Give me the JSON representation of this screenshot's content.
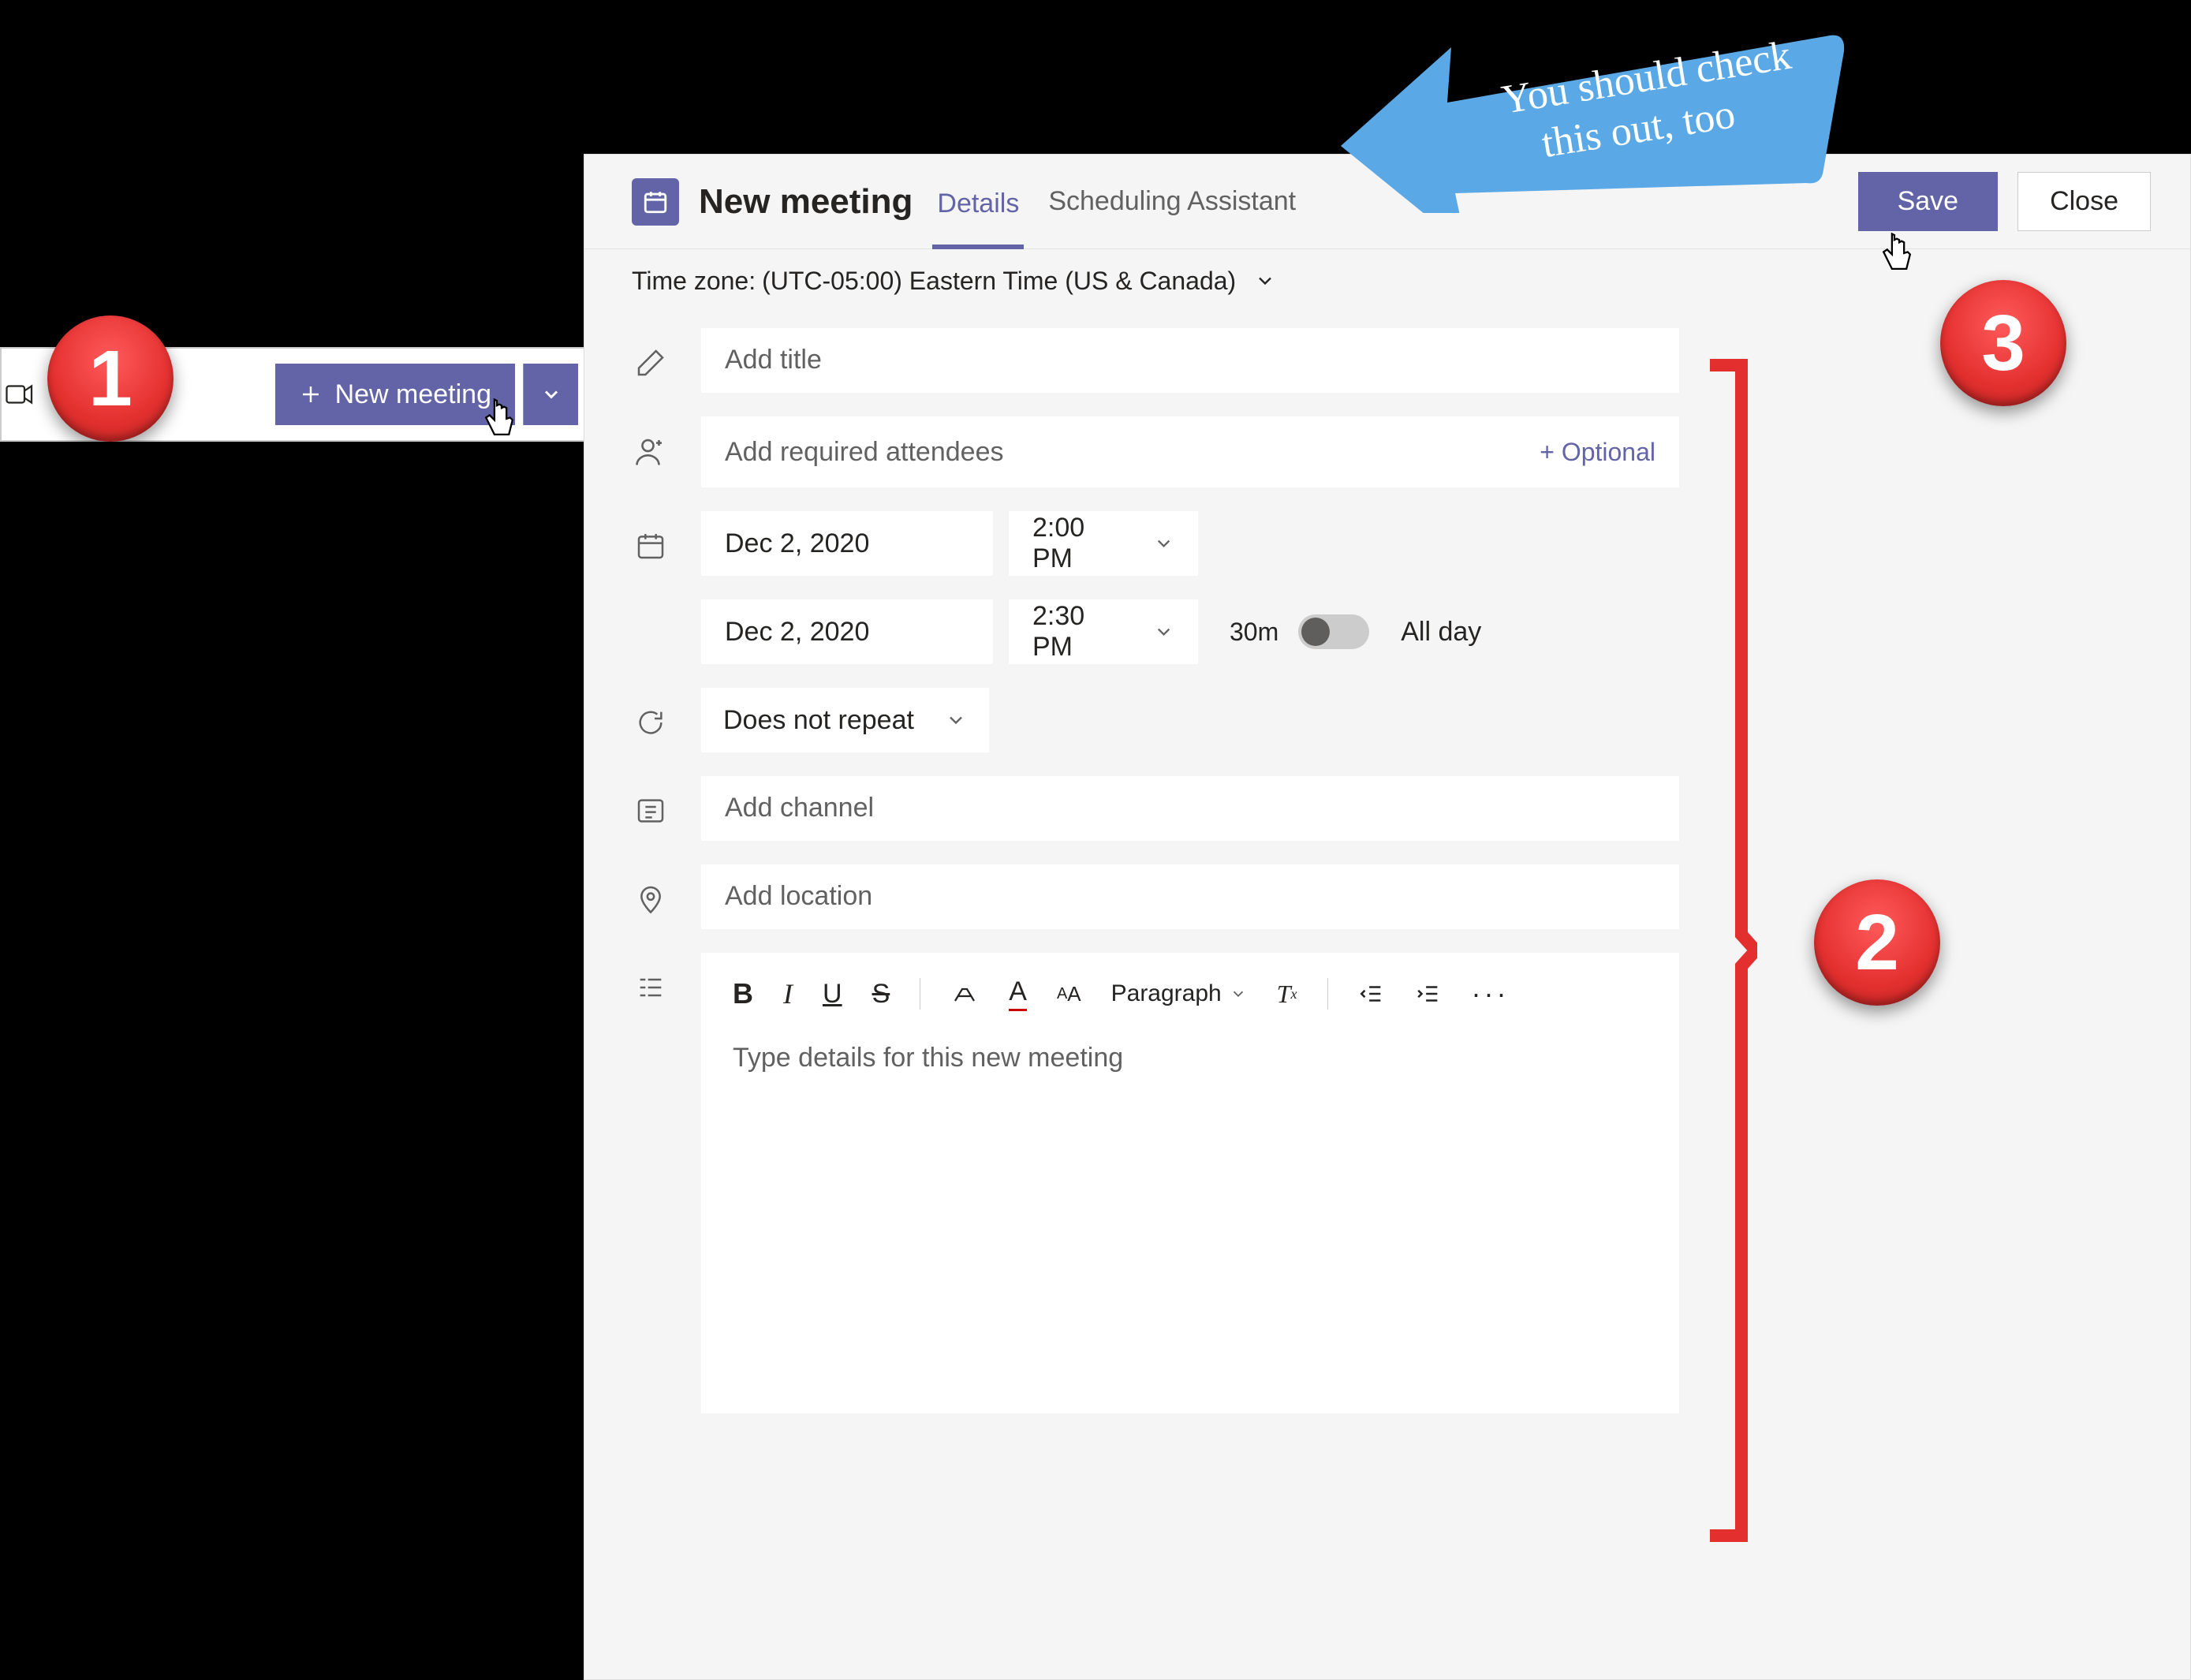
{
  "floating": {
    "new_meeting_label": "New meeting"
  },
  "header": {
    "title": "New meeting",
    "tab_details": "Details",
    "tab_scheduling": "Scheduling Assistant",
    "save_label": "Save",
    "close_label": "Close"
  },
  "timezone": {
    "label": "Time zone:",
    "value": "(UTC-05:00) Eastern Time (US & Canada)"
  },
  "form": {
    "title_placeholder": "Add title",
    "attendees_placeholder": "Add required attendees",
    "optional_link": "+ Optional",
    "start_date": "Dec 2, 2020",
    "start_time": "2:00 PM",
    "end_date": "Dec 2, 2020",
    "end_time": "2:30 PM",
    "duration": "30m",
    "all_day_label": "All day",
    "repeat_value": "Does not repeat",
    "channel_placeholder": "Add channel",
    "location_placeholder": "Add location",
    "paragraph_label": "Paragraph",
    "details_placeholder": "Type details for this new meeting"
  },
  "annotations": {
    "step1": "1",
    "step2": "2",
    "step3": "3",
    "arrow_text_line1": "You should check",
    "arrow_text_line2": "this out, too"
  },
  "colors": {
    "primary": "#6264a7",
    "callout_red": "#e3302f",
    "callout_blue": "#5aa9e6"
  }
}
